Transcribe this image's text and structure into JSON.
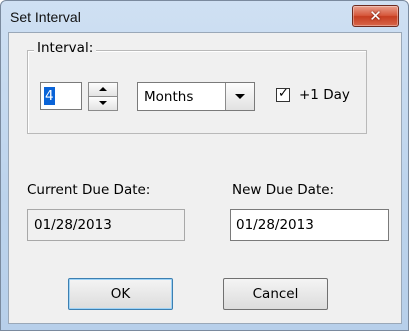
{
  "window": {
    "title": "Set Interval",
    "close_glyph": "✕"
  },
  "interval": {
    "group_label": "Interval:",
    "value": "4",
    "unit_selected": "Months",
    "plus_one_day_checked": true,
    "plus_one_day_label": "+1 Day"
  },
  "dates": {
    "current_label": "Current Due Date:",
    "current_value": "01/28/2013",
    "new_label": "New Due Date:",
    "new_value": "01/28/2013"
  },
  "buttons": {
    "ok": "OK",
    "cancel": "Cancel"
  }
}
